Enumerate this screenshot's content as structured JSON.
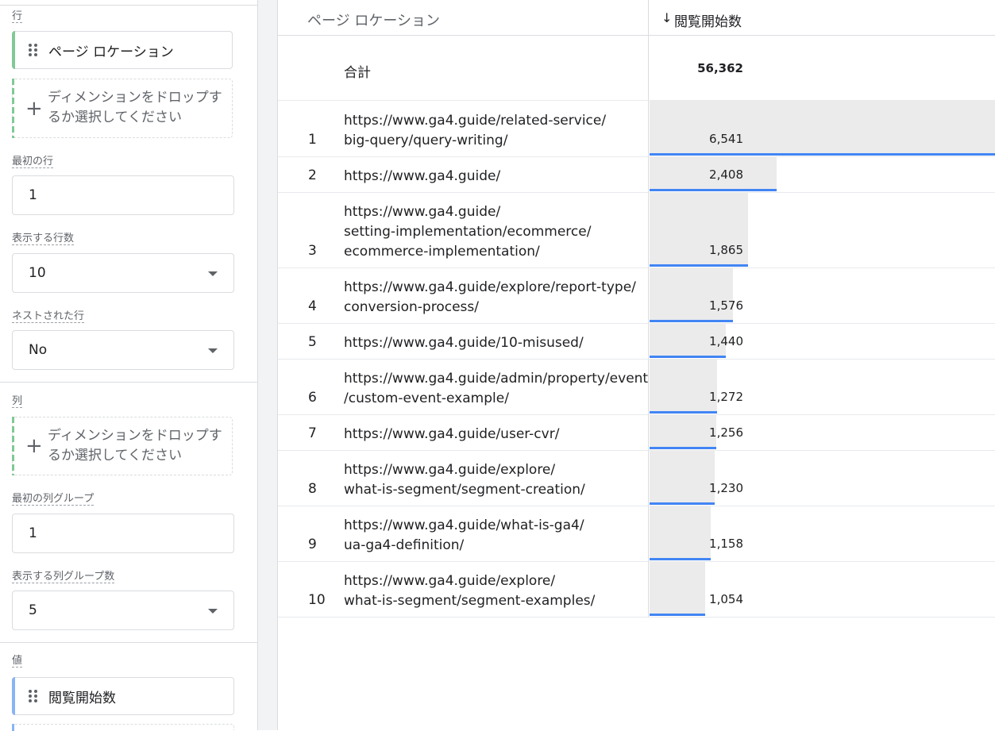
{
  "settings": {
    "rows_label": "行",
    "row_dimension": "ページ ロケーション",
    "drop_hint": "ディメンションをドロップするか選択してください",
    "start_row_label": "最初の行",
    "start_row_value": "1",
    "show_rows_label": "表示する行数",
    "show_rows_value": "10",
    "nested_rows_label": "ネストされた行",
    "nested_rows_value": "No",
    "columns_label": "列",
    "columns_drop_hint": "ディメンションをドロップするか選択してください",
    "start_col_group_label": "最初の列グループ",
    "start_col_group_value": "1",
    "show_col_groups_label": "表示する列グループ数",
    "show_col_groups_value": "5",
    "values_label": "値",
    "value_metric": "閲覧開始数"
  },
  "table": {
    "dimension_header": "ページ ロケーション",
    "metric_header": "閲覧開始数",
    "sort_icon": "arrow-down-icon",
    "total_label": "合計",
    "total_value": "56,362",
    "max_value": 6541,
    "rows": [
      {
        "rank": "1",
        "url_lines": [
          "https://www.ga4.guide/related-service/",
          "big-query/query-writing/"
        ],
        "value": "6,541",
        "num": 6541
      },
      {
        "rank": "2",
        "url_lines": [
          "https://www.ga4.guide/"
        ],
        "value": "2,408",
        "num": 2408
      },
      {
        "rank": "3",
        "url_lines": [
          "https://www.ga4.guide/",
          "setting-implementation/ecommerce/",
          "ecommerce-implementation/"
        ],
        "value": "1,865",
        "num": 1865
      },
      {
        "rank": "4",
        "url_lines": [
          "https://www.ga4.guide/explore/report-type/",
          "conversion-process/"
        ],
        "value": "1,576",
        "num": 1576
      },
      {
        "rank": "5",
        "url_lines": [
          "https://www.ga4.guide/10-misused/"
        ],
        "value": "1,440",
        "num": 1440
      },
      {
        "rank": "6",
        "url_lines": [
          "https://www.ga4.guide/admin/property/event",
          "/custom-event-example/"
        ],
        "value": "1,272",
        "num": 1272
      },
      {
        "rank": "7",
        "url_lines": [
          "https://www.ga4.guide/user-cvr/"
        ],
        "value": "1,256",
        "num": 1256
      },
      {
        "rank": "8",
        "url_lines": [
          "https://www.ga4.guide/explore/",
          "what-is-segment/segment-creation/"
        ],
        "value": "1,230",
        "num": 1230
      },
      {
        "rank": "9",
        "url_lines": [
          "https://www.ga4.guide/what-is-ga4/",
          "ua-ga4-definition/"
        ],
        "value": "1,158",
        "num": 1158
      },
      {
        "rank": "10",
        "url_lines": [
          "https://www.ga4.guide/explore/",
          "what-is-segment/segment-examples/"
        ],
        "value": "1,054",
        "num": 1054
      }
    ]
  },
  "colors": {
    "row_chip_accent": "#81c995",
    "value_chip_accent": "#8ab4f8",
    "bar_fill": "#ebebeb",
    "bar_line": "#4285f4"
  }
}
